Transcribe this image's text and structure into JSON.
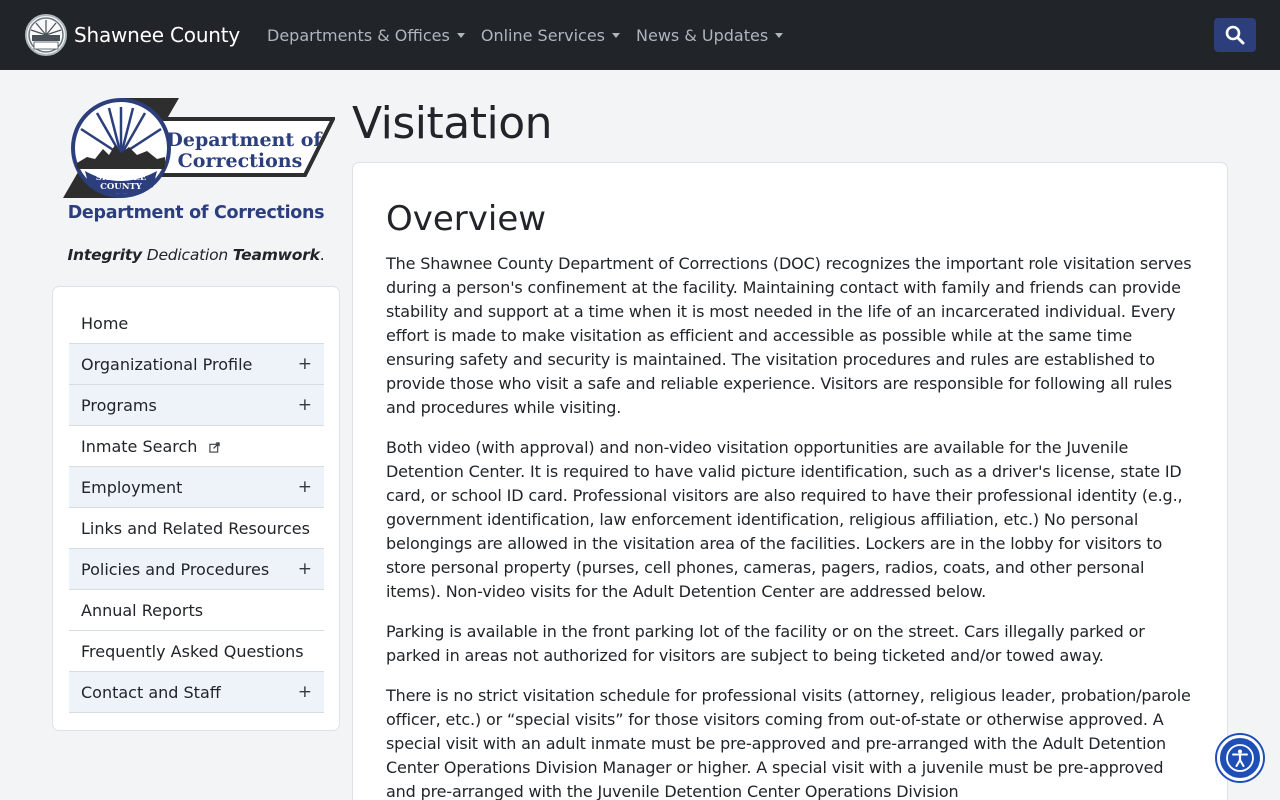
{
  "navbar": {
    "brand": "Shawnee County",
    "menu": [
      {
        "label": "Departments & Offices"
      },
      {
        "label": "Online Services"
      },
      {
        "label": "News & Updates"
      }
    ],
    "search_icon": "search-icon"
  },
  "sidebar": {
    "logo_text_line1": "Department of",
    "logo_text_line2": "Corrections",
    "seal_text_line1": "SHAWNEE",
    "seal_text_line2": "COUNTY",
    "dept_title": "Department of Corrections",
    "motto": {
      "w1": "Integrity",
      "w2": "Dedication",
      "w3": "Teamwork",
      "end": "."
    },
    "items": [
      {
        "label": "Home",
        "expandable": false
      },
      {
        "label": "Organizational Profile",
        "expandable": true,
        "toggle": "+"
      },
      {
        "label": "Programs",
        "expandable": true,
        "toggle": "+"
      },
      {
        "label": "Inmate Search",
        "expandable": false,
        "external": true
      },
      {
        "label": "Employment",
        "expandable": true,
        "toggle": "+"
      },
      {
        "label": "Links and Related Resources",
        "expandable": false
      },
      {
        "label": "Policies and Procedures",
        "expandable": true,
        "toggle": "+"
      },
      {
        "label": "Annual Reports",
        "expandable": false
      },
      {
        "label": "Frequently Asked Questions",
        "expandable": false
      },
      {
        "label": "Contact and Staff",
        "expandable": true,
        "toggle": "+"
      }
    ]
  },
  "main": {
    "page_title": "Visitation",
    "section_title": "Overview",
    "paragraphs": [
      "The Shawnee County Department of Corrections (DOC) recognizes the important role visitation serves during a person's confinement at the facility. Maintaining contact with family and friends can provide stability and support at a time when it is most needed in the life of an incarcerated individual. Every effort is made to make visitation as efficient and accessible as possible while at the same time ensuring safety and security is maintained. The visitation procedures and rules are established to provide those who visit a safe and reliable experience. Visitors are responsible for following all rules and procedures while visiting.",
      "Both video (with approval) and non-video visitation opportunities are available for the Juvenile Detention Center. It is required to have valid picture identification, such as a driver's license, state ID card, or school ID card. Professional visitors are also required to have their professional identity (e.g., government identification, law enforcement identification, religious affiliation, etc.) No personal belongings are allowed in the visitation area of the facilities. Lockers are in the lobby for visitors to store personal property (purses, cell phones, cameras, pagers, radios, coats, and other personal items). Non-video visits for the Adult Detention Center are addressed below.",
      "Parking is available in the front parking lot of the facility or on the street. Cars illegally parked or parked in areas not authorized for visitors are subject to being ticketed and/or towed away.",
      "There is no strict visitation schedule for professional visits (attorney, religious leader, probation/parole officer, etc.) or “special visits” for those visitors coming from out-of-state or otherwise approved. A special visit with an adult inmate must be pre-approved and pre-arranged with the Adult Detention Center Operations Division Manager or higher. A special visit with a juvenile must be pre-approved and pre-arranged with the Juvenile Detention Center Operations Division"
    ]
  },
  "accessibility": {
    "icon": "accessibility-icon"
  },
  "colors": {
    "navbar": "#212529",
    "accent": "#2c3e7c",
    "a11y": "#1f4fb6"
  }
}
